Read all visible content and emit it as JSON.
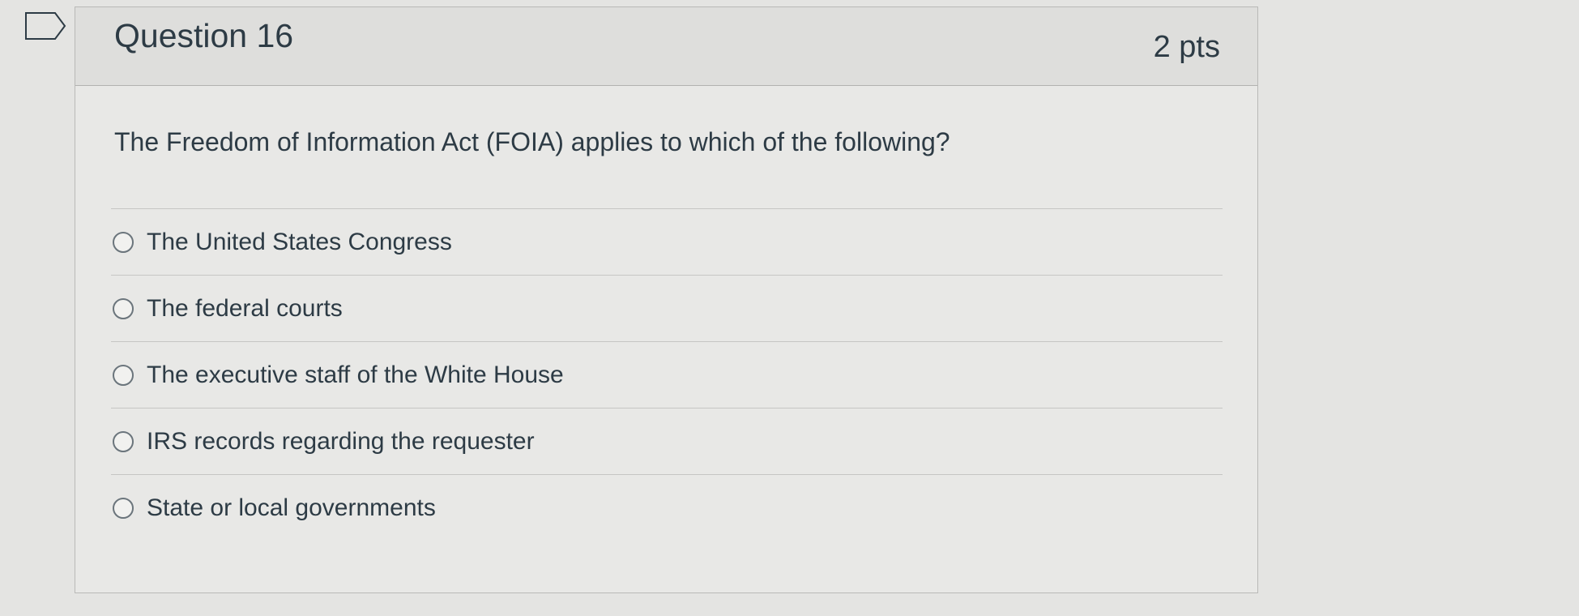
{
  "question": {
    "title": "Question 16",
    "points": "2 pts",
    "text": "The Freedom of Information Act (FOIA) applies to which of the following?",
    "flag_icon": "flag-outline-icon"
  },
  "answers": [
    {
      "label": "The United States Congress",
      "selected": false
    },
    {
      "label": "The federal courts",
      "selected": false
    },
    {
      "label": "The executive staff of the White House",
      "selected": false
    },
    {
      "label": "IRS records regarding the requester",
      "selected": false
    },
    {
      "label": "State or local governments",
      "selected": false
    }
  ],
  "colors": {
    "background": "#e4e4e2",
    "header": "#dededc",
    "text": "#2d3b45",
    "radio_border": "#6b757c"
  }
}
